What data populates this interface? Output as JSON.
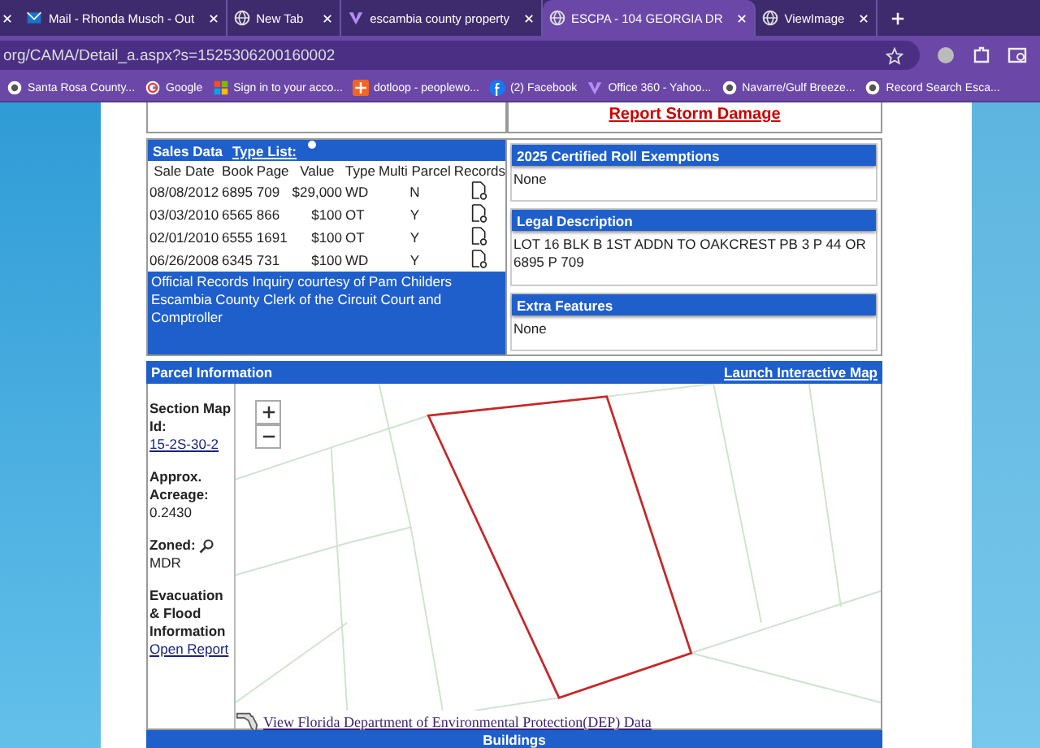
{
  "browser": {
    "tabs": [
      {
        "title": "Mail - Rhonda Musch - Out",
        "selected": false
      },
      {
        "title": "New Tab",
        "selected": false
      },
      {
        "title": "escambia county property",
        "selected": false
      },
      {
        "title": "ESCPA - 104 GEORGIA DR",
        "selected": true
      },
      {
        "title": "ViewImage",
        "selected": false
      }
    ],
    "address": "org/CAMA/Detail_a.aspx?s=1525306200160002",
    "bookmarks": [
      "Santa Rosa County...",
      "Google",
      "Sign in to your acco...",
      "dotloop - peoplewo...",
      "(2) Facebook",
      "Office 360 - Yahoo...",
      "Navarre/Gulf Breeze...",
      "Record Search Esca..."
    ]
  },
  "report_link": "Report Storm Damage",
  "sales": {
    "title": "Sales Data",
    "type_list": "Type List:",
    "columns": [
      "Sale Date",
      "Book",
      "Page",
      "Value",
      "Type",
      "Multi Parcel",
      "Records"
    ],
    "rows": [
      [
        "08/08/2012",
        "6895",
        "709",
        "$29,000",
        "WD",
        "N"
      ],
      [
        "03/03/2010",
        "6565",
        "866",
        "$100",
        "OT",
        "Y"
      ],
      [
        "02/01/2010",
        "6555",
        "1691",
        "$100",
        "OT",
        "Y"
      ],
      [
        "06/26/2008",
        "6345",
        "731",
        "$100",
        "WD",
        "Y"
      ]
    ],
    "footer": "Official Records Inquiry courtesy of Pam Childers Escambia County Clerk of the Circuit Court and Comptroller"
  },
  "side_panels": [
    {
      "title": "2025 Certified Roll Exemptions",
      "text": "None"
    },
    {
      "title": "Legal Description",
      "text": "LOT 16 BLK B 1ST ADDN TO OAKCREST PB 3 P 44 OR 6895 P 709"
    },
    {
      "title": "Extra Features",
      "text": "None"
    }
  ],
  "parcel": {
    "title": "Parcel Information",
    "map_link": "Launch Interactive Map",
    "fields": [
      {
        "label": "Section Map Id:",
        "value": "15-2S-30-2",
        "kind": "link"
      },
      {
        "label": "Approx. Acreage:",
        "value": "0.2430",
        "kind": "text"
      },
      {
        "label": "Zoned:",
        "value": "MDR",
        "kind": "zoning"
      },
      {
        "label": "Evacuation & Flood Information",
        "value": "Open Report",
        "kind": "link"
      }
    ],
    "dep_link": "View Florida Department of Environmental Protection(DEP) Data"
  },
  "buildings_title": "Buildings"
}
